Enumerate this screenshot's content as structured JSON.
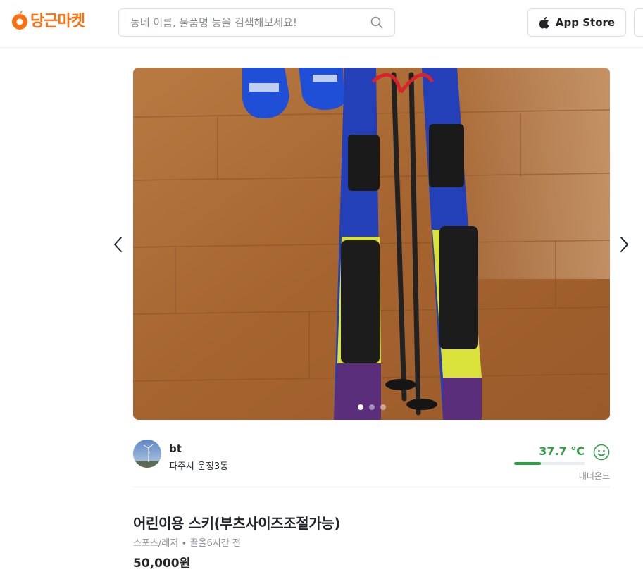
{
  "header": {
    "logo_text": "당근마켓",
    "brand_color": "#ff6f0f",
    "search": {
      "placeholder": "동네 이름, 물품명 등을 검색해보세요!",
      "value": ""
    },
    "app_store_label": "App Store",
    "app_store_icon": "apple-icon"
  },
  "carousel": {
    "image_subject": "skis-and-poles-photo",
    "total_images": 3,
    "active_index": 0,
    "prev_icon": "chevron-left-icon",
    "next_icon": "chevron-right-icon"
  },
  "seller": {
    "nickname": "bt",
    "region": "파주시 운정3동",
    "manner_temp": "37.7 °C",
    "manner_temp_level": 0.377,
    "manner_label": "매너온도",
    "temp_color": "#319e45",
    "face_icon": "smile-face-icon"
  },
  "article": {
    "title": "어린이용 스키(부츠사이즈조절가능)",
    "category_time": "스포츠/레저 ∙ 끌올6시간 전",
    "price": "50,000원"
  }
}
